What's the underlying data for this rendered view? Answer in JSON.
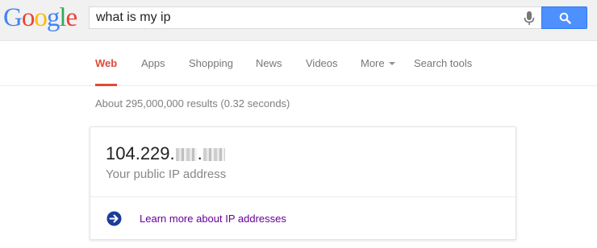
{
  "logo": {
    "letters": [
      "G",
      "o",
      "o",
      "g",
      "l",
      "e"
    ],
    "colors": [
      "#4285f4",
      "#ea4335",
      "#fbbc05",
      "#4285f4",
      "#34a853",
      "#ea4335"
    ]
  },
  "search": {
    "query": "what is my ip",
    "button_icon": "magnifier-icon",
    "mic_icon": "microphone-icon"
  },
  "tabs": [
    {
      "label": "Web",
      "active": true
    },
    {
      "label": "Apps"
    },
    {
      "label": "Shopping"
    },
    {
      "label": "News"
    },
    {
      "label": "Videos"
    },
    {
      "label": "More"
    },
    {
      "label": "Search tools"
    }
  ],
  "result_stats": "About 295,000,000 results (0.32 seconds)",
  "answer": {
    "ip_prefix": "104.229.",
    "ip_separator": ".",
    "subtitle": "Your public IP address",
    "more_link": "Learn more about IP addresses",
    "more_icon": "arrow-right-circle-icon"
  },
  "colors": {
    "accent_red": "#dd4b39",
    "button_blue": "#4d90fe",
    "link_visited": "#660099"
  }
}
